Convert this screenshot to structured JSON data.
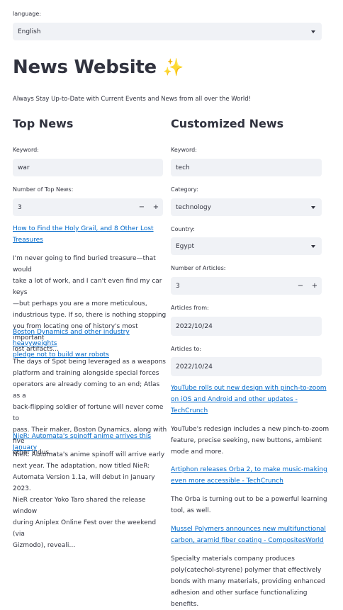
{
  "language": {
    "label": "language:",
    "value": "English"
  },
  "header": {
    "title": "News Website",
    "sparkle": "✨",
    "subtitle": "Always Stay Up-to-Date with Current Events and News from all over the World!"
  },
  "top_news": {
    "heading": "Top News",
    "keyword_label": "Keyword:",
    "keyword_value": "war",
    "count_label": "Number of Top News:",
    "count_value": "3",
    "minus": "−",
    "plus": "+",
    "articles": [
      {
        "title_line1": "How to Find the Holy Grail, and 8 Other Lost",
        "title_line2": "Treasures",
        "desc": [
          "I'm never going to find buried treasure—that would",
          "take a lot of work, and I can't even find my car keys",
          "—but perhaps you are a more meticulous,",
          "industrious type. If so, there is nothing stopping",
          "you from locating one of history's most important",
          "lost artifacts…"
        ]
      },
      {
        "title_line1": "Boston Dynamics and other industry heavyweights",
        "title_line2": "pledge not to build war robots",
        "desc": [
          "The days of Spot being leveraged as a weapons",
          "platform and training alongside special forces",
          "operators are already coming to an end; Atlas as a",
          "back-flipping soldier of fortune will never come to",
          "pass. Their maker, Boston Dynamics, along with five",
          "other indus…"
        ]
      },
      {
        "title_line1": "NieR: Automata's spinoff anime arrives this January",
        "title_line2": "",
        "desc": [
          "NieR: Automata's anime spinoff will arrive early",
          "next year. The adaptation, now titled NieR:",
          "Automata Version 1.1a, will debut in January 2023.",
          "NieR creator Yoko Taro shared the release window",
          "during Aniplex Online Fest over the weekend (via",
          "Gizmodo), reveali…"
        ]
      }
    ]
  },
  "custom_news": {
    "heading": "Customized News",
    "keyword_label": "Keyword:",
    "keyword_value": "tech",
    "category_label": "Category:",
    "category_value": "technology",
    "country_label": "Country:",
    "country_value": "Egypt",
    "count_label": "Number of Articles:",
    "count_value": "3",
    "minus": "−",
    "plus": "+",
    "from_label": "Articles from:",
    "from_value": "2022/10/24",
    "to_label": "Articles to:",
    "to_value": "2022/10/24",
    "articles": [
      {
        "title": [
          "YouTube rolls out new design with pinch-to-zoom",
          "on iOS and Android and other updates -",
          "TechCrunch"
        ],
        "desc": [
          "YouTube's redesign includes a new pinch-to-zoom",
          "feature, precise seeking, new buttons, ambient",
          "mode and more."
        ]
      },
      {
        "title": [
          "Artiphon releases Orba 2, to make music-making",
          "even more accessible - TechCrunch"
        ],
        "desc": [
          "The Orba is turning out to be a powerful learning",
          "tool, as well."
        ]
      },
      {
        "title": [
          "Mussel Polymers announces new multifunctional",
          "carbon, aramid fiber coating - CompositesWorld"
        ],
        "desc": [
          "Specialty materials company produces",
          "poly(catechol-styrene) polymer that effectively",
          "bonds with many materials, providing enhanced",
          "adhesion and other surface functionalizing",
          "benefits."
        ]
      }
    ]
  }
}
